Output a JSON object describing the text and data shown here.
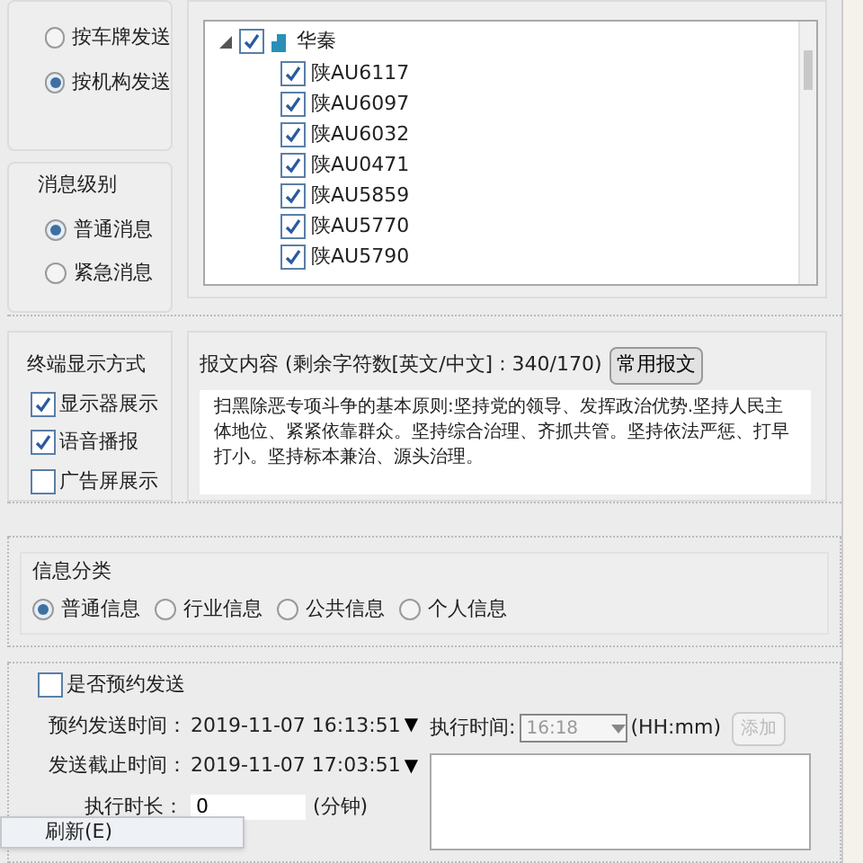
{
  "send_range": {
    "options": [
      {
        "label": "按车牌发送",
        "selected": false
      },
      {
        "label": "按机构发送",
        "selected": true
      }
    ]
  },
  "message_level": {
    "title": "消息级别",
    "options": [
      {
        "label": "普通消息",
        "selected": true
      },
      {
        "label": "紧急消息",
        "selected": false
      }
    ]
  },
  "vehicle_tree": {
    "root": {
      "label": "华秦",
      "checked": true,
      "expanded": true,
      "children": [
        {
          "label": "陕AU6117",
          "checked": true
        },
        {
          "label": "陕AU6097",
          "checked": true
        },
        {
          "label": "陕AU6032",
          "checked": true
        },
        {
          "label": "陕AU0471",
          "checked": true
        },
        {
          "label": "陕AU5859",
          "checked": true
        },
        {
          "label": "陕AU5770",
          "checked": true
        },
        {
          "label": "陕AU5790",
          "checked": true
        }
      ]
    }
  },
  "display_mode": {
    "title": "终端显示方式",
    "options": [
      {
        "label": "显示器展示",
        "checked": true
      },
      {
        "label": "语音播报",
        "checked": true
      },
      {
        "label": "广告屏展示",
        "checked": false
      }
    ]
  },
  "message": {
    "label": "报文内容 (剩余字符数[英文/中文] : 340/170)",
    "button": "常用报文",
    "value": "扫黑除恶专项斗争的基本原则:坚持党的领导、发挥政治优势.坚持人民主体地位、紧紧依靠群众。坚持综合治理、齐抓共管。坚持依法严惩、打早打小。坚持标本兼治、源头治理。"
  },
  "info_category": {
    "title": "信息分类",
    "options": [
      {
        "label": "普通信息",
        "selected": true
      },
      {
        "label": "行业信息",
        "selected": false
      },
      {
        "label": "公共信息",
        "selected": false
      },
      {
        "label": "个人信息",
        "selected": false
      }
    ]
  },
  "schedule": {
    "label": "是否预约发送",
    "checked": false,
    "send_time_label": "预约发送时间：",
    "send_time": "2019-11-07 16:13:51",
    "send_time_arrow": "▼",
    "deadline_label": "发送截止时间：",
    "deadline": "2019-11-07 17:03:51",
    "deadline_arrow": "▼",
    "duration_label": "执行时长：",
    "duration": "0",
    "duration_unit": "(分钟)",
    "exec_time_label": "执行时间:",
    "exec_time": "16:18",
    "exec_time_format": "(HH:mm)",
    "add_button": "添加",
    "add_disabled": true
  },
  "context_menu": {
    "items": [
      "刷新(E)"
    ]
  }
}
